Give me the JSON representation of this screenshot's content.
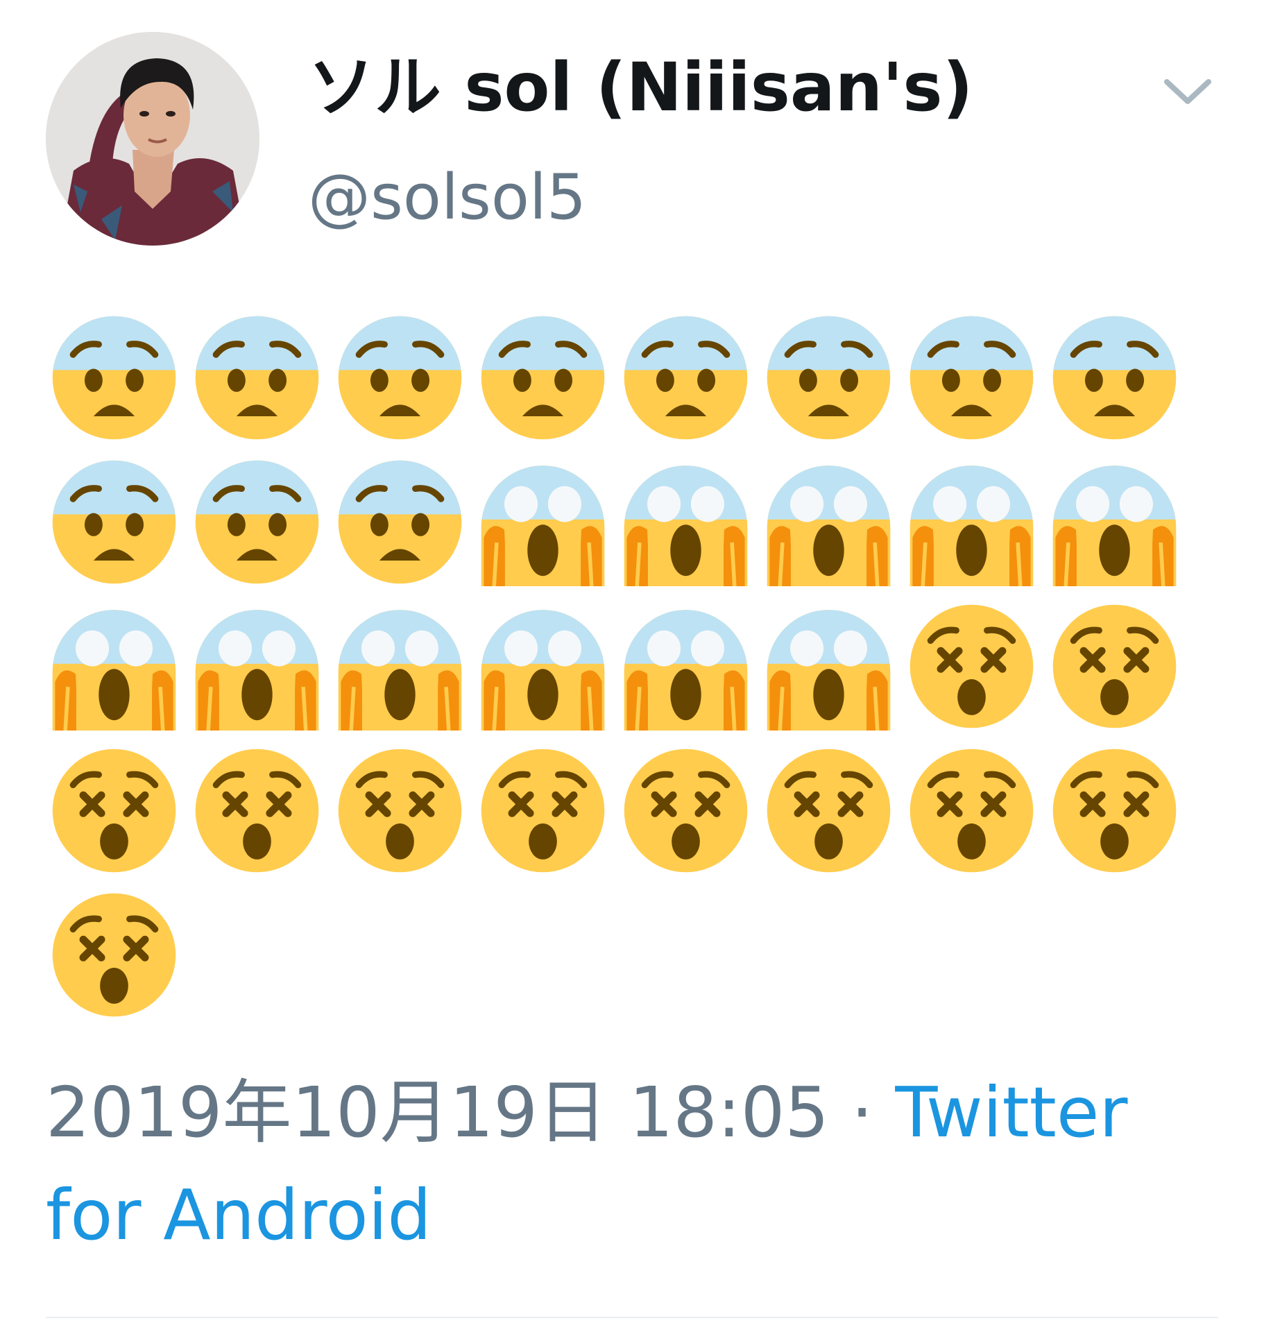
{
  "tweet": {
    "display_name": "ソル sol (Niiisan's)",
    "handle": "@solsol5",
    "timestamp": "2019年10月19日 18:05",
    "separator": " · ",
    "source": "Twitter for Android"
  },
  "emojis": [
    "anxious-face",
    "anxious-face",
    "anxious-face",
    "anxious-face",
    "anxious-face",
    "anxious-face",
    "anxious-face",
    "anxious-face",
    "anxious-face",
    "anxious-face",
    "anxious-face",
    "screaming-face",
    "screaming-face",
    "screaming-face",
    "screaming-face",
    "screaming-face",
    "screaming-face",
    "screaming-face",
    "screaming-face",
    "screaming-face",
    "screaming-face",
    "screaming-face",
    "dizzy-face",
    "dizzy-face",
    "dizzy-face",
    "dizzy-face",
    "dizzy-face",
    "dizzy-face",
    "dizzy-face",
    "dizzy-face",
    "dizzy-face",
    "dizzy-face",
    "dizzy-face"
  ],
  "icons": {
    "menu": "chevron-down-icon",
    "avatar": "profile-photo"
  }
}
